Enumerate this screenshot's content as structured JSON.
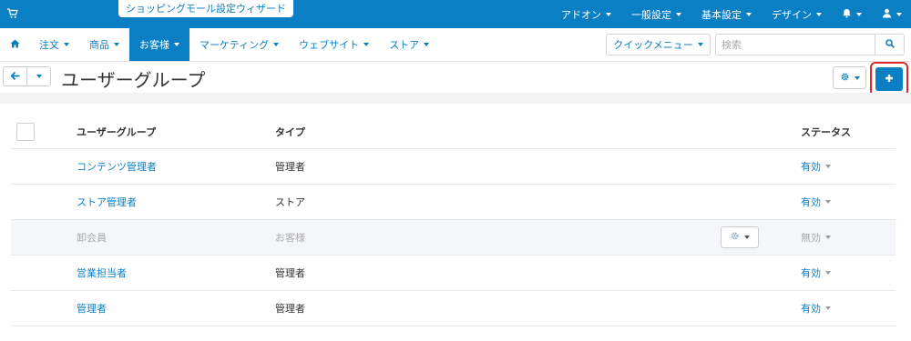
{
  "topbar": {
    "wizard_label": "ショッピングモール設定ウィザード",
    "nav": [
      "アドオン",
      "一般設定",
      "基本設定",
      "デザイン"
    ]
  },
  "mainnav": {
    "items": [
      {
        "label": "注文",
        "active": false
      },
      {
        "label": "商品",
        "active": false
      },
      {
        "label": "お客様",
        "active": true
      },
      {
        "label": "マーケティング",
        "active": false
      },
      {
        "label": "ウェブサイト",
        "active": false
      },
      {
        "label": "ストア",
        "active": false
      }
    ],
    "quick_menu_label": "クイックメニュー",
    "search_placeholder": "検索"
  },
  "page": {
    "title": "ユーザーグループ"
  },
  "table": {
    "headers": {
      "name": "ユーザーグループ",
      "type": "タイプ",
      "status": "ステータス"
    },
    "rows": [
      {
        "name": "コンテンツ管理者",
        "type": "管理者",
        "status": "有効",
        "highlighted": false
      },
      {
        "name": "ストア管理者",
        "type": "ストア",
        "status": "有効",
        "highlighted": false
      },
      {
        "name": "卸会員",
        "type": "お客様",
        "status": "無効",
        "highlighted": true
      },
      {
        "name": "営業担当者",
        "type": "管理者",
        "status": "有効",
        "highlighted": false
      },
      {
        "name": "管理者",
        "type": "管理者",
        "status": "有効",
        "highlighted": false
      }
    ]
  },
  "colors": {
    "brand": "#0b7fc4",
    "highlight_box": "#e02a2a",
    "row_highlight": "#f4f6fa"
  }
}
